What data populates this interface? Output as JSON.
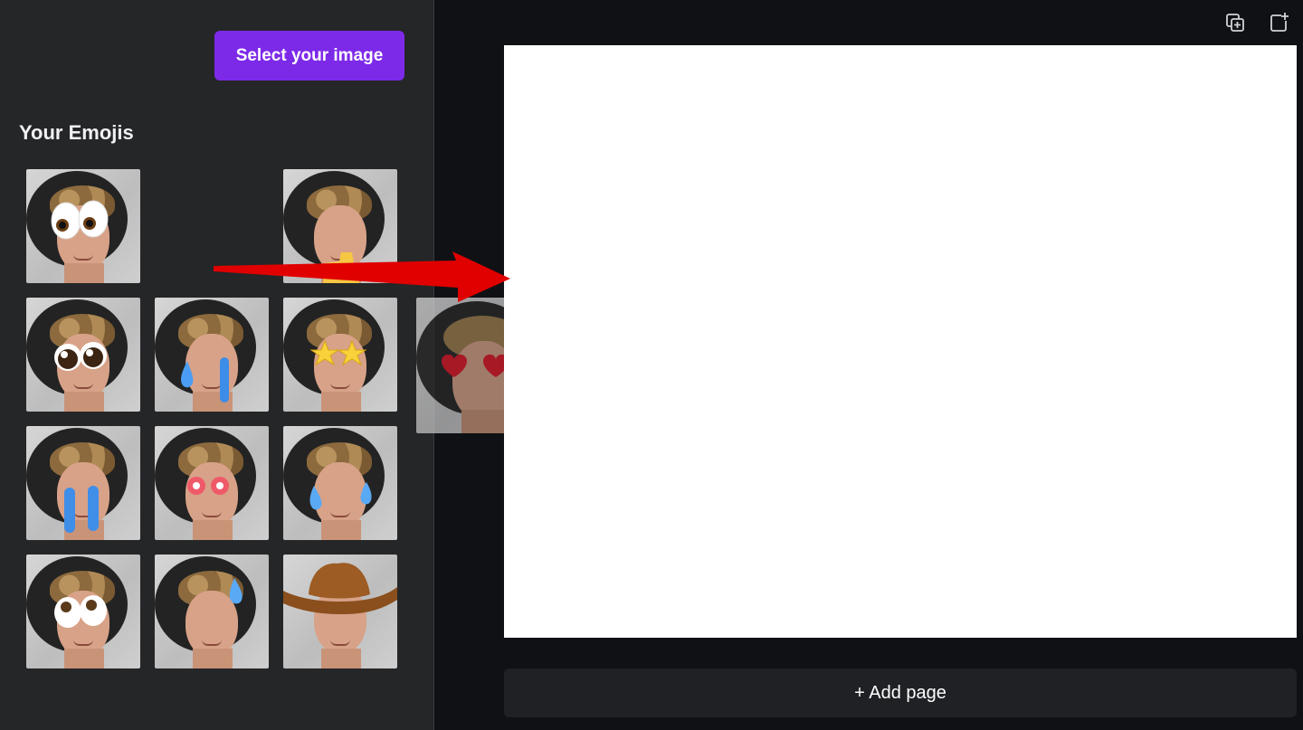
{
  "sidebar": {
    "select_button_label": "Select your image",
    "section_title": "Your Emojis",
    "thumbnails": [
      {
        "emoji": "eyes-emoji"
      },
      {
        "emoji": "thumbs-up-emoji"
      },
      {
        "emoji": "pleading-eyes-emoji"
      },
      {
        "emoji": "loudly-crying-emoji"
      },
      {
        "emoji": "star-eyes-emoji"
      },
      {
        "emoji": "crying-tears-emoji"
      },
      {
        "emoji": "glowing-red-eyes-emoji"
      },
      {
        "emoji": "sweat-drops-emoji"
      },
      {
        "emoji": "rolling-eyes-emoji"
      },
      {
        "emoji": "sweat-drop-emoji"
      },
      {
        "emoji": "cowboy-hat-emoji"
      }
    ],
    "dragged_thumbnail": {
      "emoji": "heart-eyes-emoji"
    }
  },
  "toolbar": {
    "icons": [
      "duplicate-page-icon",
      "add-page-icon"
    ]
  },
  "canvas": {
    "add_page_label": "+ Add page"
  },
  "colors": {
    "accent": "#7d2ae8",
    "panel": "#252628",
    "background": "#0f1115",
    "arrow": "#e00000"
  }
}
